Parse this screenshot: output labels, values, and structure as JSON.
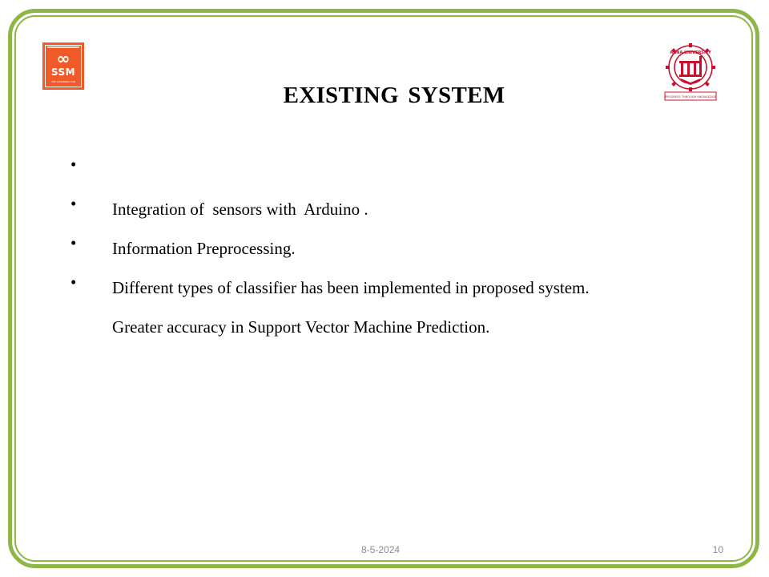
{
  "slide": {
    "title": "EXISTING  SYSTEM",
    "bullets": [
      "Integration of  sensors with  Arduino .",
      "Information Preprocessing.",
      "Different types of classifier has been implemented in proposed system.",
      "Greater accuracy in Support Vector Machine Prediction."
    ],
    "bullet_glyph": "•",
    "footer_date": "8-5-2024",
    "page_number": "10"
  },
  "logos": {
    "left": {
      "symbol": "∞",
      "text": "SSM",
      "tagline": "THE LEARNING HUB",
      "color": "#f05a28"
    },
    "right": {
      "arc_text": "ANNA UNIVERSITY",
      "motto": "PROGRESS THROUGH KNOWLEDGE",
      "color": "#c8102e"
    }
  },
  "colors": {
    "frame": "#8db646"
  }
}
